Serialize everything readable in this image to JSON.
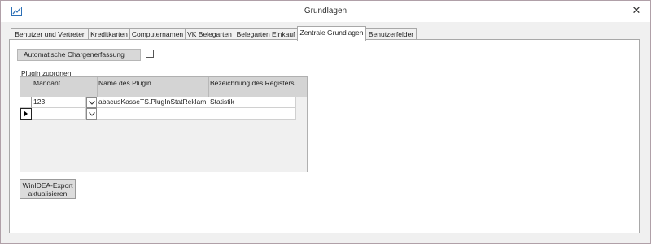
{
  "window": {
    "title": "Grundlagen",
    "app_icon": "chart-line-icon",
    "close_glyph": "✕"
  },
  "tabs": [
    {
      "label": "Benutzer und Vertreter",
      "active": false
    },
    {
      "label": "Kreditkarten",
      "active": false
    },
    {
      "label": "Computernamen",
      "active": false
    },
    {
      "label": "VK Belegarten",
      "active": false
    },
    {
      "label": "Belegarten Einkauf",
      "active": false
    },
    {
      "label": "Zentrale Grundlagen",
      "active": true
    },
    {
      "label": "Benutzerfelder",
      "active": false
    }
  ],
  "settings": {
    "auto_charge_label": "Automatische Chargenerfassung",
    "auto_charge_checked": false
  },
  "plugin": {
    "section_label": "Plugin zuordnen",
    "columns": [
      "Mandant",
      "Name des Plugin",
      "Bezeichnung des Registers"
    ],
    "rows": [
      {
        "mandant": "123",
        "plugin": "abacusKasseTS.PlugInStatReklam",
        "register": "Statistik"
      },
      {
        "mandant": "",
        "plugin": "",
        "register": ""
      }
    ],
    "current_row_indicator": "row-pointer-arrow"
  },
  "buttons": {
    "export_line1": "WinIDEA-Export",
    "export_line2": "aktualisieren"
  },
  "colors": {
    "accent": "#2c6fb6",
    "control_bg": "#d8d8d8",
    "panel_bg": "#f0f0f0"
  }
}
